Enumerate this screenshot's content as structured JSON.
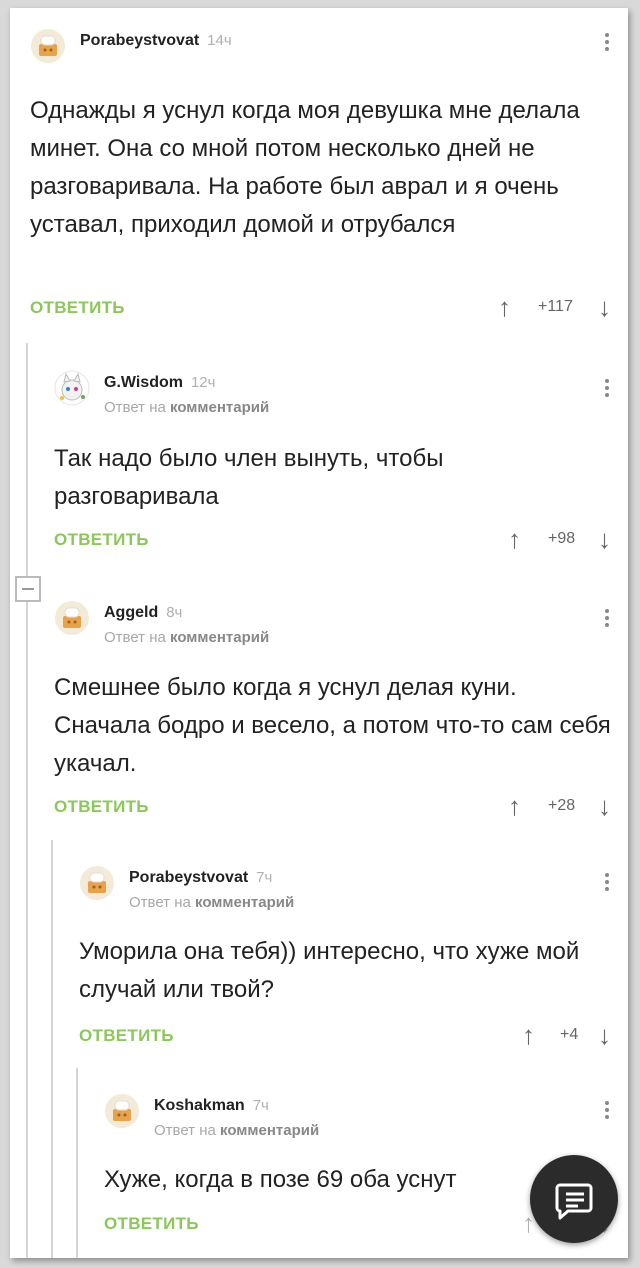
{
  "comments": [
    {
      "author": "Porabeystvovat",
      "time": "14ч",
      "text": "Однажды я уснул когда моя девушка мне делала минет. Она со мной потом несколько дней не разговаривала. На работе был аврал и я очень уставал, приходил домой и отрубался",
      "reply_label": "ОТВЕТИТЬ",
      "votes": "+117"
    },
    {
      "author": "G.Wisdom",
      "time": "12ч",
      "reply_to_prefix": "Ответ на",
      "reply_to_link": "комментарий",
      "text": "Так надо было член вынуть, чтобы разговаривала",
      "reply_label": "ОТВЕТИТЬ",
      "votes": "+98"
    },
    {
      "author": "Aggeld",
      "time": "8ч",
      "reply_to_prefix": "Ответ на",
      "reply_to_link": "комментарий",
      "text": "Смешнее было когда я уснул делая куни. Сначала бодро и весело, а потом что-то сам себя укачал.",
      "reply_label": "ОТВЕТИТЬ",
      "votes": "+28"
    },
    {
      "author": "Porabeystvovat",
      "time": "7ч",
      "reply_to_prefix": "Ответ на",
      "reply_to_link": "комментарий",
      "text": "Уморила она тебя)) интересно, что хуже мой случай или твой?",
      "reply_label": "ОТВЕТИТЬ",
      "votes": "+4"
    },
    {
      "author": "Koshakman",
      "time": "7ч",
      "reply_to_prefix": "Ответ на",
      "reply_to_link": "комментарий",
      "text": "Хуже, когда в позе 69 оба уснут",
      "reply_label": "ОТВЕТИТЬ"
    }
  ],
  "icons": {
    "upvote": "arrow-up-icon",
    "downvote": "arrow-down-icon",
    "menu": "more-vertical-icon",
    "fab": "comment-icon"
  },
  "colors": {
    "reply": "#8ac858",
    "text": "#222222",
    "muted": "#a8a8a8",
    "fab": "#2b2b2b"
  }
}
